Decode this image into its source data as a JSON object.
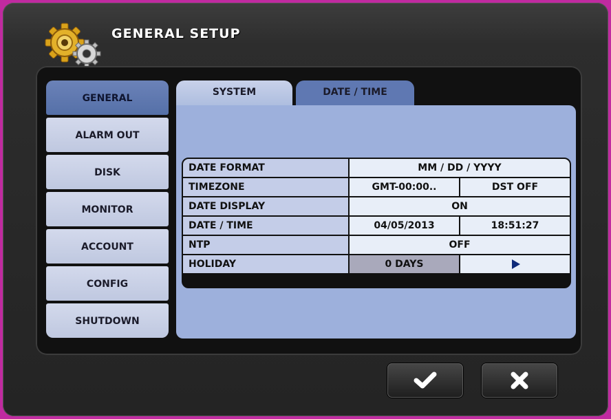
{
  "window": {
    "title": "GENERAL SETUP"
  },
  "sidebar": {
    "items": [
      {
        "label": "GENERAL",
        "active": true
      },
      {
        "label": "ALARM OUT"
      },
      {
        "label": "DISK"
      },
      {
        "label": "MONITOR"
      },
      {
        "label": "ACCOUNT"
      },
      {
        "label": "CONFIG"
      },
      {
        "label": "SHUTDOWN"
      }
    ]
  },
  "tabs": [
    {
      "label": "SYSTEM"
    },
    {
      "label": "DATE / TIME",
      "active": true
    }
  ],
  "settings": {
    "date_format": {
      "label": "DATE FORMAT",
      "value": "MM / DD / YYYY"
    },
    "timezone": {
      "label": "TIMEZONE",
      "value": "GMT-00:00..",
      "dst": "DST OFF"
    },
    "date_display": {
      "label": "DATE DISPLAY",
      "value": "ON"
    },
    "date_time": {
      "label": "DATE / TIME",
      "date": "04/05/2013",
      "time": "18:51:27"
    },
    "ntp": {
      "label": "NTP",
      "value": "OFF"
    },
    "holiday": {
      "label": "HOLIDAY",
      "value": "0 DAYS",
      "icon": "play-arrow-icon"
    }
  },
  "footer": {
    "confirm_icon": "checkmark-icon",
    "cancel_icon": "close-icon"
  },
  "colors": {
    "accent": "#5f78b2",
    "panel": "#9db0dc",
    "tab_inactive": "#c8d1ea"
  }
}
